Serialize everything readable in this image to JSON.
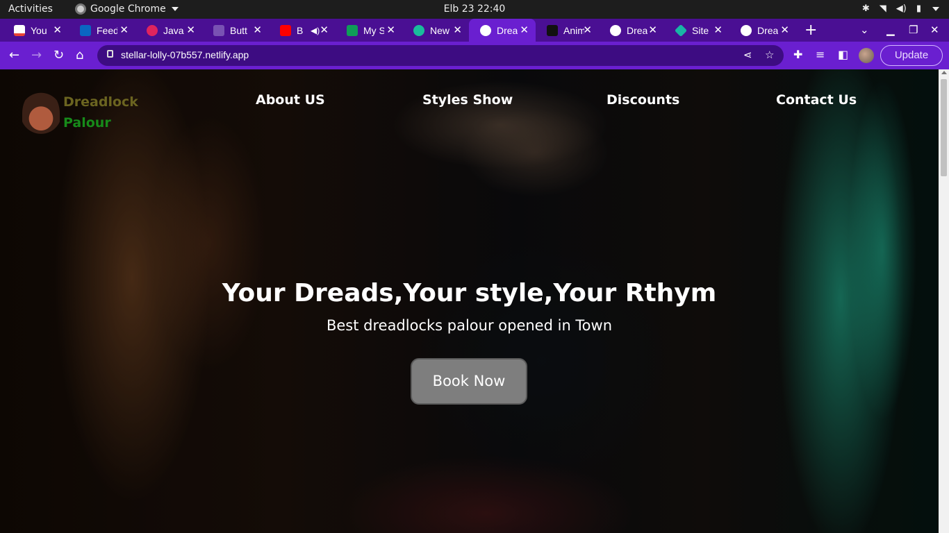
{
  "system": {
    "activities": "Activities",
    "app_name": "Google Chrome",
    "clock": "Elb 23  22:40"
  },
  "browser": {
    "tabs": [
      {
        "title": "You",
        "favicon_color": "#ea4335",
        "icon": "gmail-icon"
      },
      {
        "title": "Feed",
        "favicon_color": "#0a66c2",
        "icon": "linkedin-icon"
      },
      {
        "title": "Java",
        "favicon_color": "#e0245e",
        "icon": "video-icon"
      },
      {
        "title": "Butt",
        "favicon_color": "#7952b3",
        "icon": "bootstrap-icon"
      },
      {
        "title": "B",
        "favicon_color": "#ff0000",
        "icon": "youtube-icon"
      },
      {
        "title": "My S",
        "favicon_color": "#0f9d58",
        "icon": "sheets-icon"
      },
      {
        "title": "New",
        "favicon_color": "#1abc9c",
        "icon": "m-icon"
      },
      {
        "title": "Drea",
        "favicon_color": "#ffffff",
        "icon": "globe-icon",
        "active": true
      },
      {
        "title": "Anim",
        "favicon_color": "#111111",
        "icon": "a-icon"
      },
      {
        "title": "Drea",
        "favicon_color": "#ffffff",
        "icon": "globe-icon"
      },
      {
        "title": "Site",
        "favicon_color": "#19b5a6",
        "icon": "diamond-icon"
      },
      {
        "title": "Drea",
        "favicon_color": "#ffffff",
        "icon": "globe-icon"
      }
    ],
    "url": "stellar-lolly-07b557.netlify.app",
    "update_label": "Update"
  },
  "page": {
    "brand_line1": "Dreadlock",
    "brand_line2": "Palour",
    "nav": [
      "About US",
      "Styles Show",
      "Discounts",
      "Contact Us"
    ],
    "hero_title": "Your Dreads,Your style,Your Rthym",
    "hero_subtitle": "Best dreadlocks palour opened in Town",
    "cta_label": "Book Now"
  },
  "colors": {
    "tabstrip": "#4a0f93",
    "toolbar": "#6a1fd0",
    "brand_line1": "#6b6420",
    "brand_line2": "#178a1a",
    "cta_bg": "#7e7e7e"
  }
}
